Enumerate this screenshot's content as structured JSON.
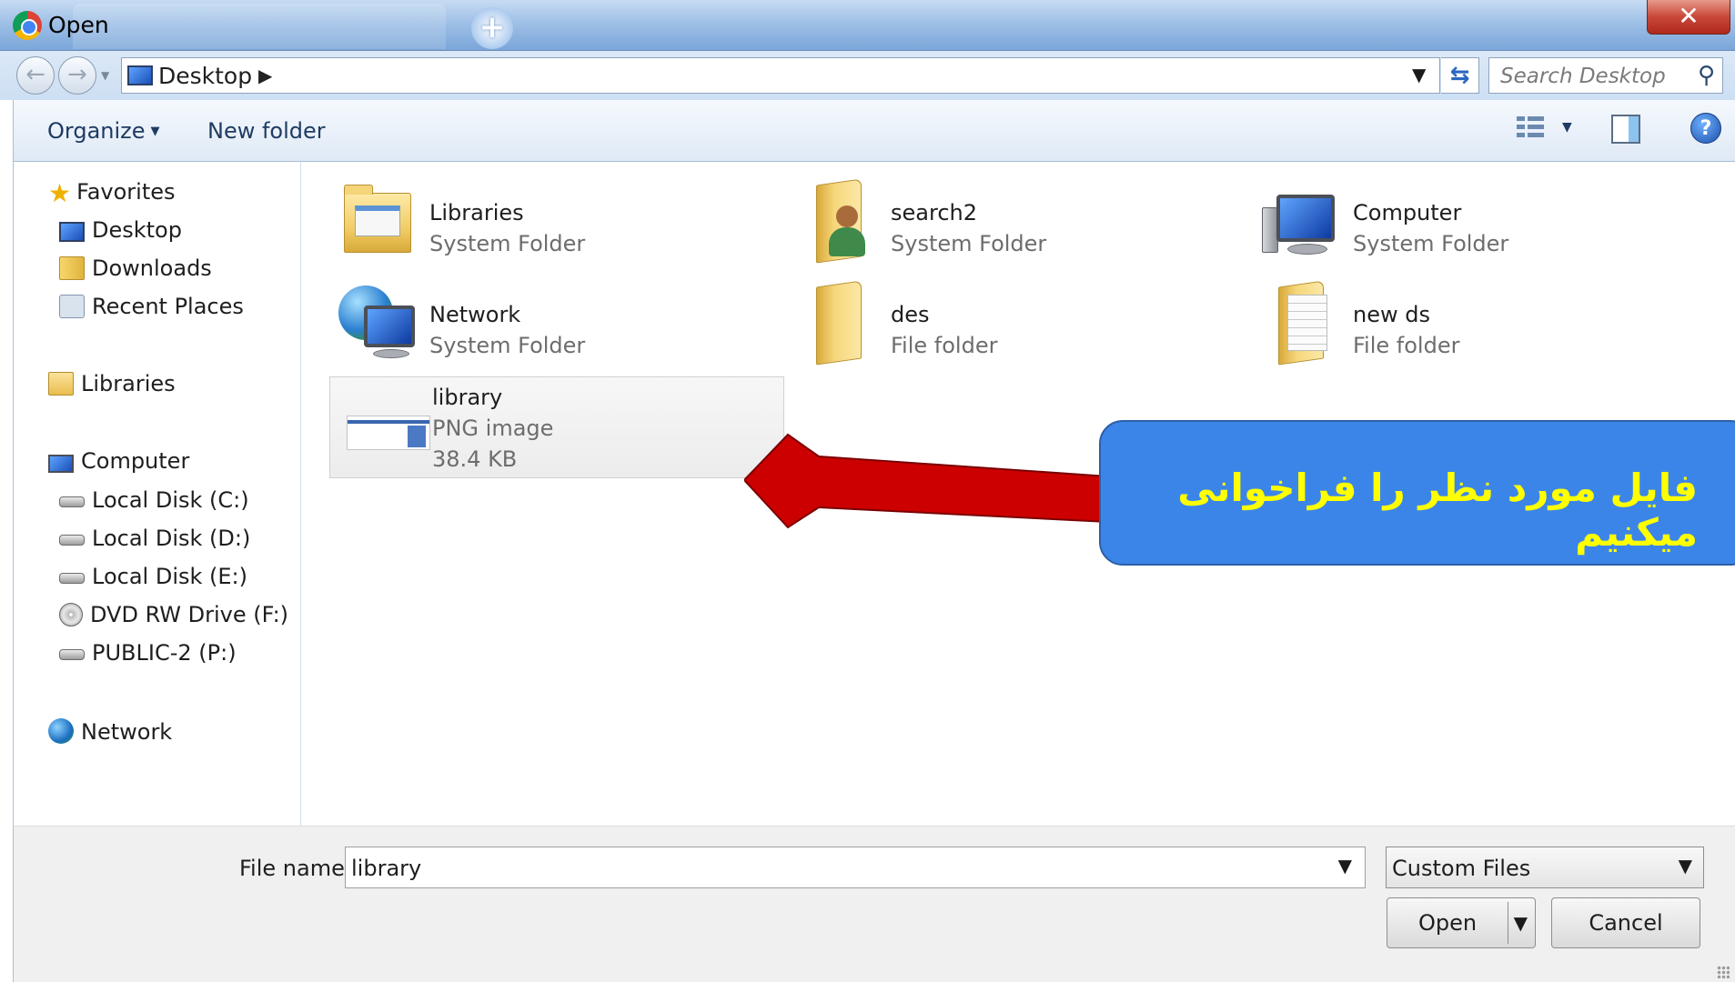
{
  "window": {
    "title": "Open",
    "close_label": "✕"
  },
  "address": {
    "location": "Desktop",
    "search_placeholder": "Search Desktop"
  },
  "toolbar": {
    "organize_label": "Organize",
    "new_folder_label": "New folder"
  },
  "sidebar": {
    "favorites": "Favorites",
    "favorites_items": [
      "Desktop",
      "Downloads",
      "Recent Places"
    ],
    "libraries": "Libraries",
    "computer": "Computer",
    "computer_items": [
      "Local Disk (C:)",
      "Local Disk (D:)",
      "Local Disk (E:)",
      "DVD RW Drive (F:)",
      "PUBLIC-2 (P:)"
    ],
    "network": "Network"
  },
  "files": [
    {
      "name": "Libraries",
      "type": "System Folder",
      "icon": "libraries-folder-icon"
    },
    {
      "name": "search2",
      "type": "System Folder",
      "icon": "user-folder-icon"
    },
    {
      "name": "Computer",
      "type": "System Folder",
      "icon": "computer-icon"
    },
    {
      "name": "Network",
      "type": "System Folder",
      "icon": "network-globe-icon"
    },
    {
      "name": "des",
      "type": "File folder",
      "icon": "folder-icon"
    },
    {
      "name": "new ds",
      "type": "File folder",
      "icon": "folder-documents-icon"
    },
    {
      "name": "library",
      "type": "PNG image",
      "size": "38.4 KB",
      "icon": "png-thumbnail-icon",
      "selected": true
    }
  ],
  "callout": {
    "text": "فایل مورد نظر را فراخوانی میکنیم",
    "background_color": "#3c85e8",
    "text_color": "#ffff00",
    "arrow_color": "#cc0000"
  },
  "footer": {
    "file_name_label": "File name:",
    "file_name_value": "library",
    "filter_value": "Custom Files",
    "open_label": "Open",
    "cancel_label": "Cancel"
  }
}
